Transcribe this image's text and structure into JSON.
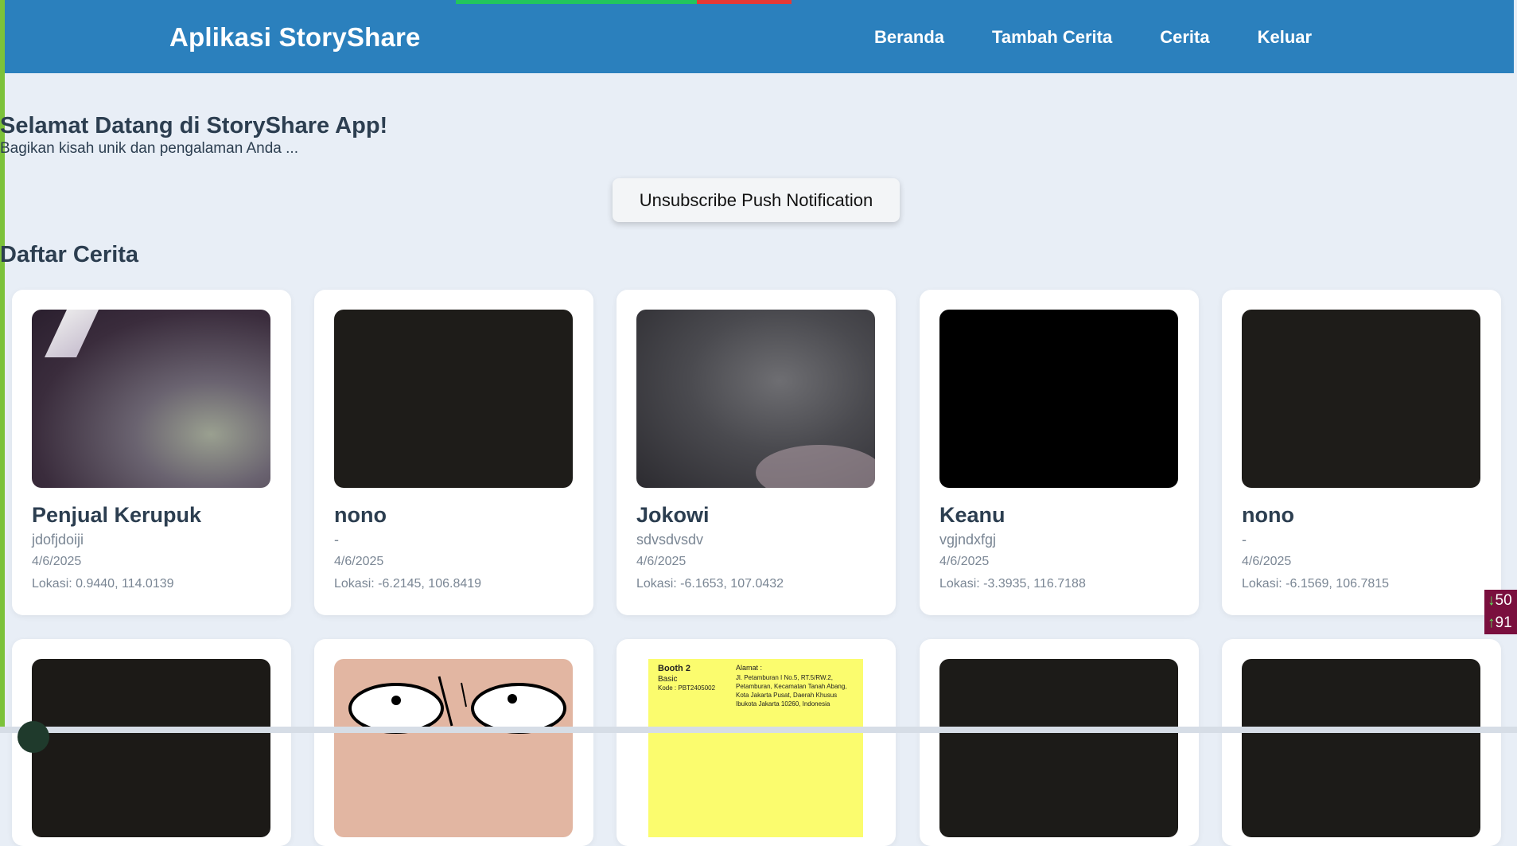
{
  "app": {
    "title": "Aplikasi StoryShare",
    "nav": [
      "Beranda",
      "Tambah Cerita",
      "Cerita",
      "Keluar"
    ]
  },
  "hero": {
    "title": "Selamat Datang di StoryShare App!",
    "subtitle": "Bagikan kisah unik dan pengalaman Anda ..."
  },
  "push_button": "Unsubscribe Push Notification",
  "list_title": "Daftar Cerita",
  "stories": [
    {
      "name": "Penjual Kerupuk",
      "desc": "jdofjdoiji",
      "date": "4/6/2025",
      "location": "Lokasi: 0.9440, 114.0139"
    },
    {
      "name": "nono",
      "desc": "-",
      "date": "4/6/2025",
      "location": "Lokasi: -6.2145, 106.8419"
    },
    {
      "name": "Jokowi",
      "desc": "sdvsdvsdv",
      "date": "4/6/2025",
      "location": "Lokasi: -6.1653, 107.0432"
    },
    {
      "name": "Keanu",
      "desc": "vgjndxfgj",
      "date": "4/6/2025",
      "location": "Lokasi: -3.3935, 116.7188"
    },
    {
      "name": "nono",
      "desc": "-",
      "date": "4/6/2025",
      "location": "Lokasi: -6.1569, 106.7815"
    }
  ],
  "booth_card": {
    "title": "Booth 2",
    "type": "Basic",
    "code": "Kode : PBT2405002",
    "address_label": "Alamat :",
    "address": "Jl. Petamburan I No.5, RT.5/RW.2, Petamburan, Kecamatan Tanah Abang, Kota Jakarta Pusat, Daerah Khusus Ibukota Jakarta 10260, Indonesia"
  },
  "speed": {
    "down": "50",
    "up": "91"
  },
  "colors": {
    "header": "#2b80bd",
    "background": "#e8eef6"
  }
}
